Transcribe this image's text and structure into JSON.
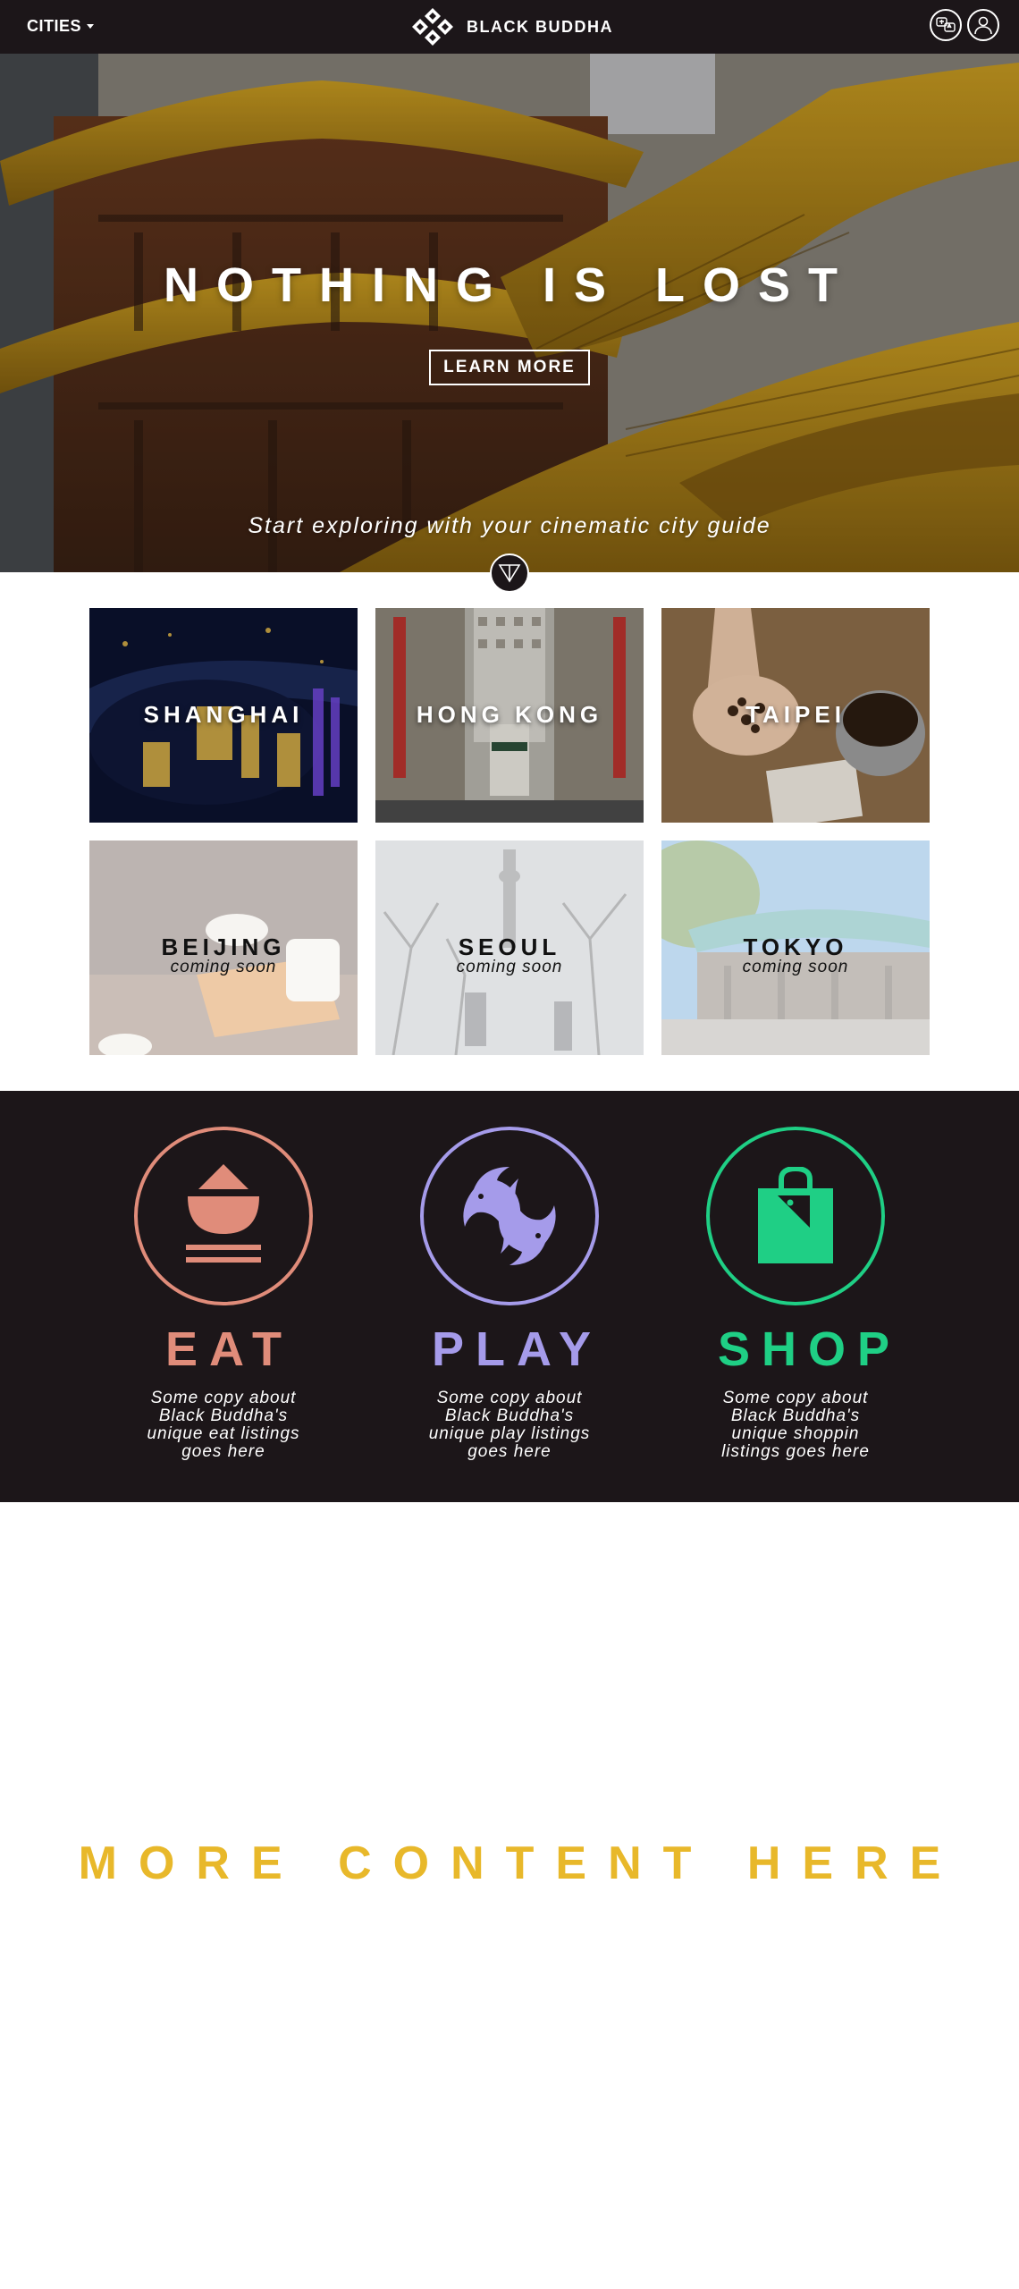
{
  "nav": {
    "cities_label": "CITIES",
    "brand_name": "BLACK BUDDHA",
    "icons": [
      "brand-logo-icon",
      "language-icon",
      "user-icon"
    ]
  },
  "hero": {
    "title": "NOTHING IS LOST",
    "cta_label": "LEARN MORE",
    "tagline": "Start exploring with your cinematic city guide"
  },
  "cities": [
    {
      "name": "SHANGHAI",
      "status": ""
    },
    {
      "name": "HONG KONG",
      "status": ""
    },
    {
      "name": "TAIPEI",
      "status": ""
    },
    {
      "name": "BEIJING",
      "status": "coming soon"
    },
    {
      "name": "SEOUL",
      "status": "coming soon"
    },
    {
      "name": "TOKYO",
      "status": "coming soon"
    }
  ],
  "categories": [
    {
      "title": "EAT",
      "copy": "Some copy about Black Buddha's unique eat listings goes here",
      "color": "#e08c7a",
      "icon": "bowl-icon"
    },
    {
      "title": "PLAY",
      "copy": "Some copy about Black Buddha's unique play listings goes here",
      "color": "#a59bea",
      "icon": "koi-fish-icon"
    },
    {
      "title": "SHOP",
      "copy": "Some copy about Black Buddha's unique shoppin listings goes here",
      "color": "#1fcf85",
      "icon": "shopping-bag-icon"
    }
  ],
  "more": {
    "label": "MORE CONTENT HERE"
  },
  "colors": {
    "nav_bg": "#1c1619",
    "accent_yellow": "#e8b82a",
    "eat": "#e08c7a",
    "play": "#a59bea",
    "shop": "#1fcf85"
  }
}
